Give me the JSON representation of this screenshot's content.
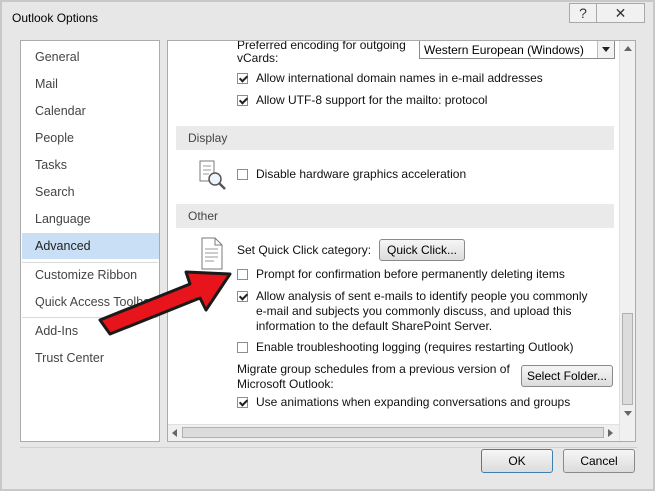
{
  "window": {
    "title": "Outlook Options",
    "help_glyph": "?",
    "close_glyph": "✕"
  },
  "nav": {
    "items": [
      {
        "label": "General"
      },
      {
        "label": "Mail"
      },
      {
        "label": "Calendar"
      },
      {
        "label": "People"
      },
      {
        "label": "Tasks"
      },
      {
        "label": "Search"
      },
      {
        "label": "Language"
      },
      {
        "label": "Advanced"
      },
      {
        "label": "Customize Ribbon"
      },
      {
        "label": "Quick Access Toolbar"
      },
      {
        "label": "Add-Ins"
      },
      {
        "label": "Trust Center"
      }
    ],
    "selected": "Advanced"
  },
  "content": {
    "encoding": {
      "label_line1": "Preferred encoding for outgoing",
      "label_line2": "vCards:",
      "selected_value": "Western European (Windows)"
    },
    "intl_domains": {
      "label": "Allow international domain names in e-mail addresses",
      "checked": true
    },
    "utf8_mailto": {
      "label": "Allow UTF-8 support for the mailto: protocol",
      "checked": true
    },
    "display_header": "Display",
    "disable_hw_accel": {
      "label": "Disable hardware graphics acceleration",
      "checked": false
    },
    "other_header": "Other",
    "quick_click": {
      "label": "Set Quick Click category:",
      "button": "Quick Click..."
    },
    "prompt_delete": {
      "label": "Prompt for confirmation before permanently deleting items",
      "checked": false
    },
    "analysis": {
      "line1": "Allow analysis of sent e-mails to identify people you commonly",
      "line2": "e-mail and subjects you commonly discuss, and upload this",
      "line3": "information to the default SharePoint Server.",
      "checked": true
    },
    "troubleshoot": {
      "label": "Enable troubleshooting logging (requires restarting Outlook)",
      "checked": false
    },
    "migrate": {
      "line1": "Migrate group schedules from a previous version of",
      "line2": "Microsoft Outlook:",
      "button": "Select Folder..."
    },
    "animations": {
      "label": "Use animations when expanding conversations and groups",
      "checked": true
    }
  },
  "footer": {
    "ok": "OK",
    "cancel": "Cancel"
  },
  "colors": {
    "selected_nav": "#c9dff5",
    "arrow_red": "#e8141b"
  }
}
